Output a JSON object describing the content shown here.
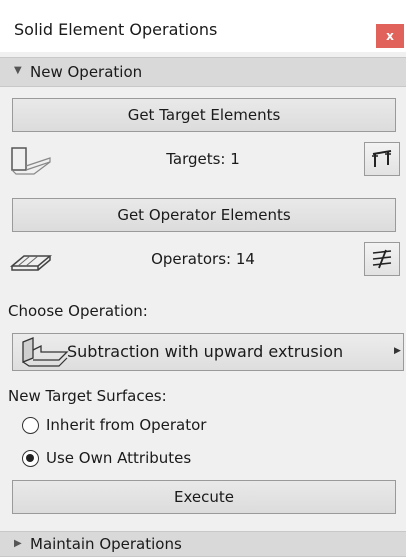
{
  "window": {
    "title": "Solid Element Operations",
    "close_label": "x"
  },
  "new_operation": {
    "header": "New Operation",
    "get_target_label": "Get Target Elements",
    "targets_text": "Targets: 1",
    "get_operator_label": "Get Operator Elements",
    "operators_text": "Operators: 14",
    "choose_operation_label": "Choose Operation:",
    "operation_selected": "Subtraction with upward extrusion",
    "new_target_surfaces_label": "New Target Surfaces:",
    "radio_options": [
      {
        "label": "Inherit from Operator",
        "checked": false
      },
      {
        "label": "Use Own Attributes",
        "checked": true
      }
    ],
    "execute_label": "Execute"
  },
  "maintain_operations": {
    "header": "Maintain Operations"
  },
  "icons": {
    "targets_icon": "target-slab-icon",
    "targets_highlight_icon": "highlight-targets-icon",
    "operators_icon": "operator-slab-icon",
    "operators_highlight_icon": "highlight-operators-icon",
    "operation_icon": "subtraction-extrusion-icon"
  }
}
